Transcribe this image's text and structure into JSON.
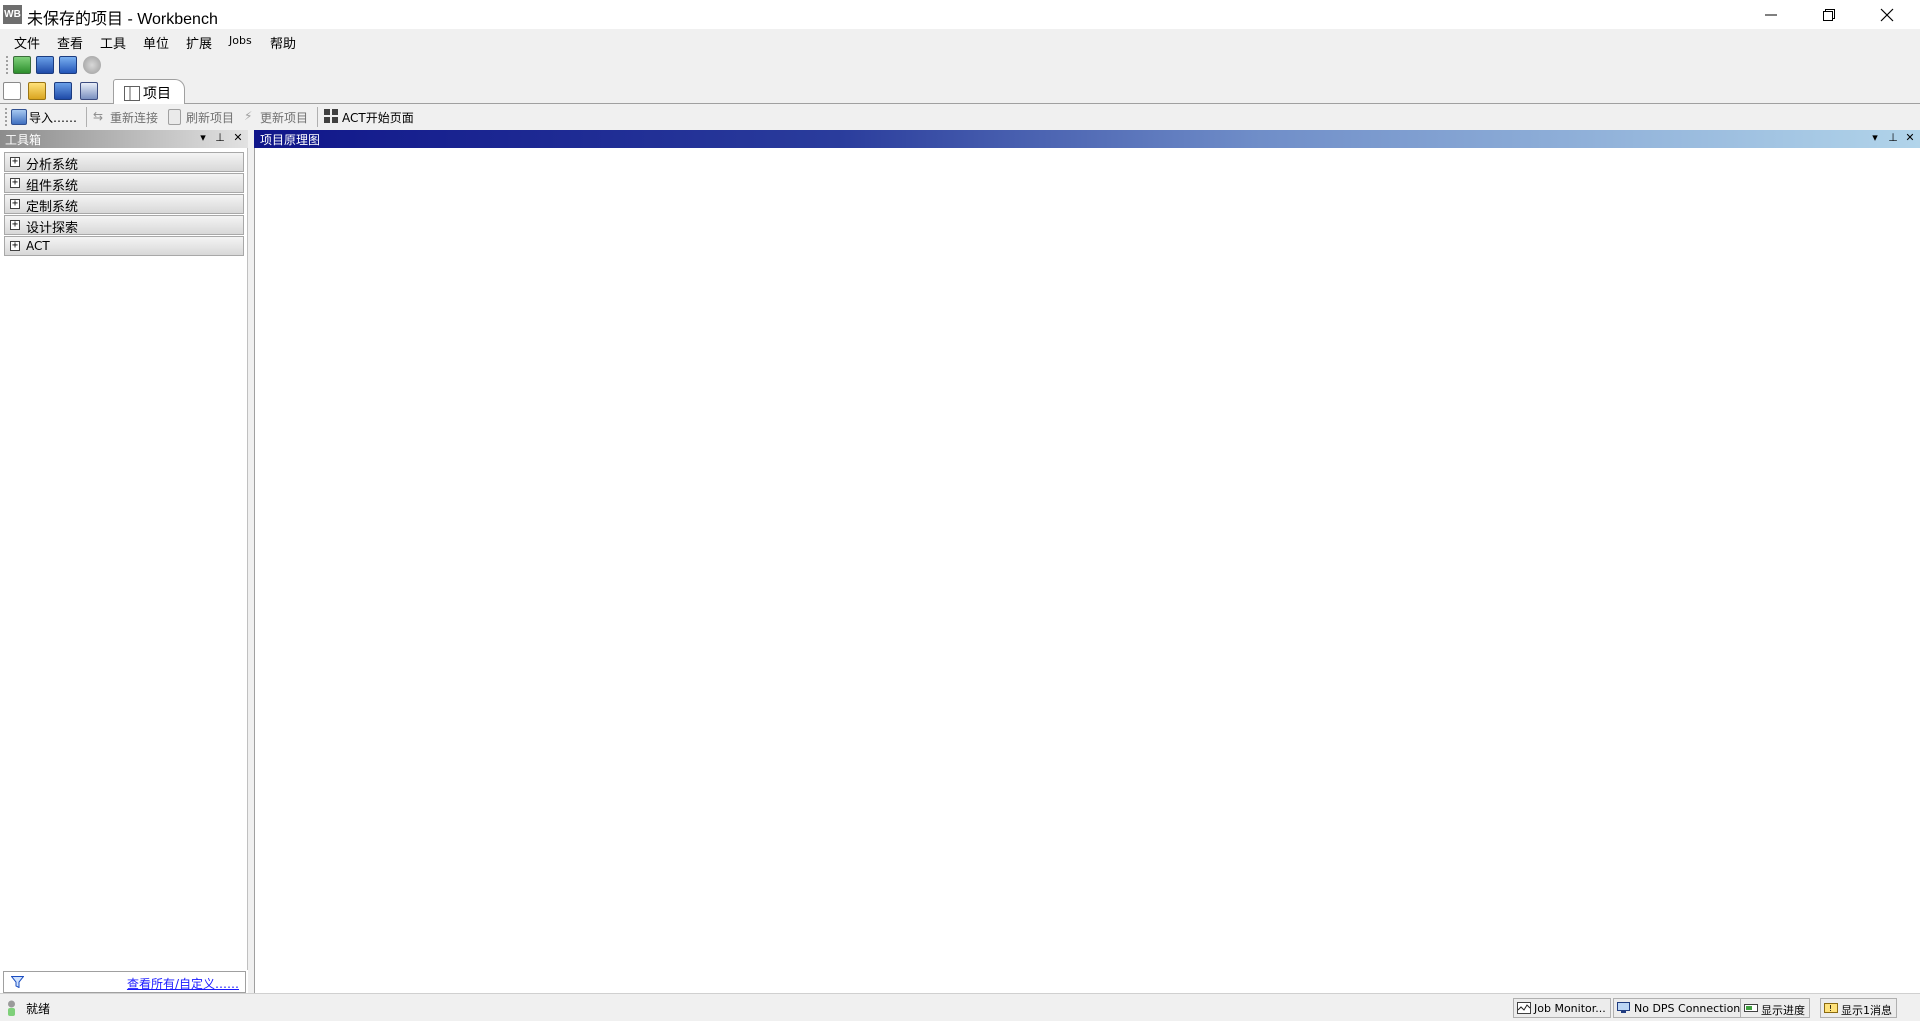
{
  "window": {
    "app_icon_text": "WB",
    "title": "未保存的项目 - Workbench"
  },
  "menu": {
    "items": [
      "文件",
      "查看",
      "工具",
      "单位",
      "扩展",
      "Jobs",
      "帮助"
    ]
  },
  "toolbar_top": {
    "icons": [
      "import-project-icon",
      "save-icon",
      "save-as-icon",
      "refresh-icon"
    ]
  },
  "toolbar_project": {
    "icons": [
      "new-icon",
      "open-icon",
      "save-icon",
      "save-as-icon"
    ],
    "tab_label": "项目"
  },
  "toolbar_actions": {
    "import_label": "导入……",
    "reconnect_label": "重新连接",
    "refresh_project_label": "刷新项目",
    "update_project_label": "更新项目",
    "act_start_label": "ACT开始页面"
  },
  "toolbox": {
    "title": "工具箱",
    "categories": [
      "分析系统",
      "组件系统",
      "定制系统",
      "设计探索",
      "ACT"
    ],
    "filter_link": "查看所有/自定义……"
  },
  "schematic": {
    "title": "项目原理图"
  },
  "status": {
    "text": "就绪",
    "buttons": [
      "Job Monitor...",
      "No DPS Connection",
      "显示进度",
      "显示1消息"
    ]
  },
  "colors": {
    "chrome": "#f0f0f0",
    "schematic_header_start": "#10168a",
    "schematic_header_end": "#b1d4ea",
    "toolbox_header": "#8c8c8c",
    "link": "#1a1aff"
  }
}
